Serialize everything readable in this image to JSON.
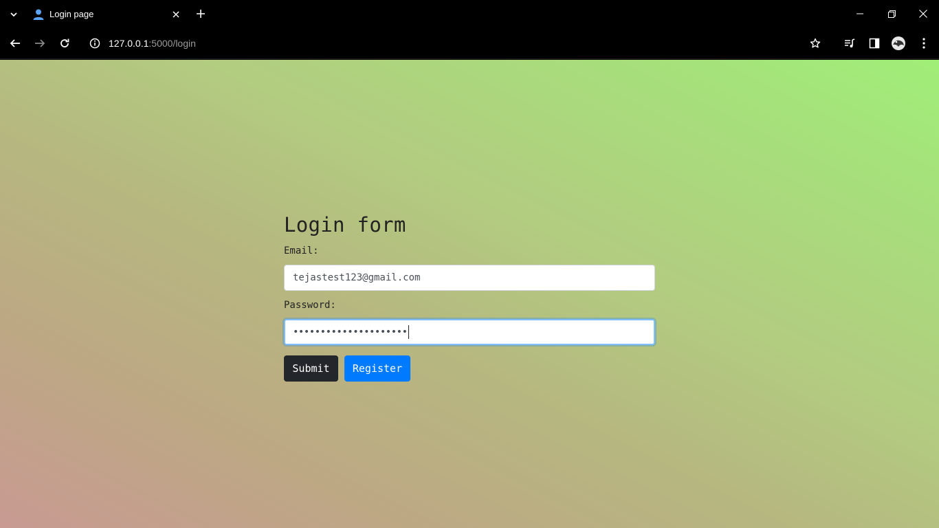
{
  "browser": {
    "tab": {
      "title": "Login page"
    },
    "url": {
      "host": "127.0.0.1",
      "path": ":5000/login"
    }
  },
  "page": {
    "title": "Login form",
    "email": {
      "label": "Email:",
      "value": "tejastest123@gmail.com"
    },
    "password": {
      "label": "Password:",
      "masked_value": "•••••••••••••••••••••"
    },
    "buttons": {
      "submit": "Submit",
      "register": "Register"
    }
  },
  "colors": {
    "submit_bg": "#23272b",
    "register_bg": "#007bff",
    "focus_ring": "#80bdff"
  },
  "icons": {
    "tab": "user-icon",
    "site_info": "info-icon"
  }
}
